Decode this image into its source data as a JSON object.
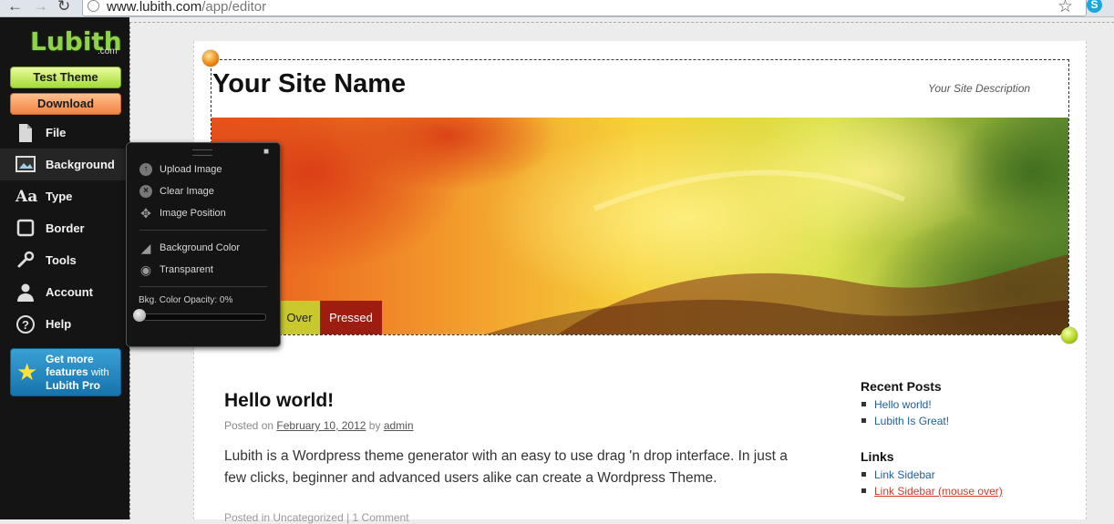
{
  "browser": {
    "url_domain": "www.lubith.com",
    "url_path": "/app/editor"
  },
  "sidebar": {
    "logo": "Lubith",
    "logo_suffix": ".com",
    "test_theme_label": "Test Theme",
    "download_label": "Download",
    "items": [
      {
        "label": "File",
        "icon": "file-icon"
      },
      {
        "label": "Background",
        "icon": "image-icon"
      },
      {
        "label": "Type",
        "icon": "type-icon"
      },
      {
        "label": "Border",
        "icon": "border-icon"
      },
      {
        "label": "Tools",
        "icon": "wrench-icon"
      },
      {
        "label": "Account",
        "icon": "user-icon"
      },
      {
        "label": "Help",
        "icon": "help-icon"
      }
    ],
    "pro": {
      "line1": "Get more",
      "line2": "features",
      "line2_suffix": "with",
      "line3": "Lubith Pro"
    }
  },
  "panel": {
    "items": [
      {
        "label": "Upload Image",
        "icon": "upload-icon"
      },
      {
        "label": "Clear Image",
        "icon": "clear-icon"
      },
      {
        "label": "Image Position",
        "icon": "move-icon"
      },
      {
        "label": "Background Color",
        "icon": "paint-bucket-icon"
      },
      {
        "label": "Transparent",
        "icon": "transparent-icon"
      }
    ],
    "opacity_label": "Bkg. Color Opacity: 0%",
    "opacity_value": 0
  },
  "site": {
    "name": "Your Site Name",
    "description": "Your Site Description",
    "nav_over": "Over",
    "nav_pressed": "Pressed"
  },
  "post": {
    "title": "Hello world!",
    "meta_prefix": "Posted on",
    "date": "February 10, 2012",
    "meta_by": "by",
    "author": "admin",
    "body": "Lubith is a Wordpress theme generator with an easy to use drag 'n drop interface. In just a few clicks, beginner and advanced users alike can create a Wordpress Theme.",
    "footer": "Posted in Uncategorized | 1 Comment"
  },
  "widgets": {
    "recent_title": "Recent Posts",
    "recent_items": [
      "Hello world!",
      "Lubith Is Great!"
    ],
    "links_title": "Links",
    "link_items": [
      "Link Sidebar",
      "Link Sidebar (mouse over)"
    ]
  },
  "colors": {
    "accent_green": "#a6dc3b",
    "accent_orange": "#f2833f",
    "pressed_red": "#9e1c10",
    "over_yellow": "#c9c92e"
  }
}
